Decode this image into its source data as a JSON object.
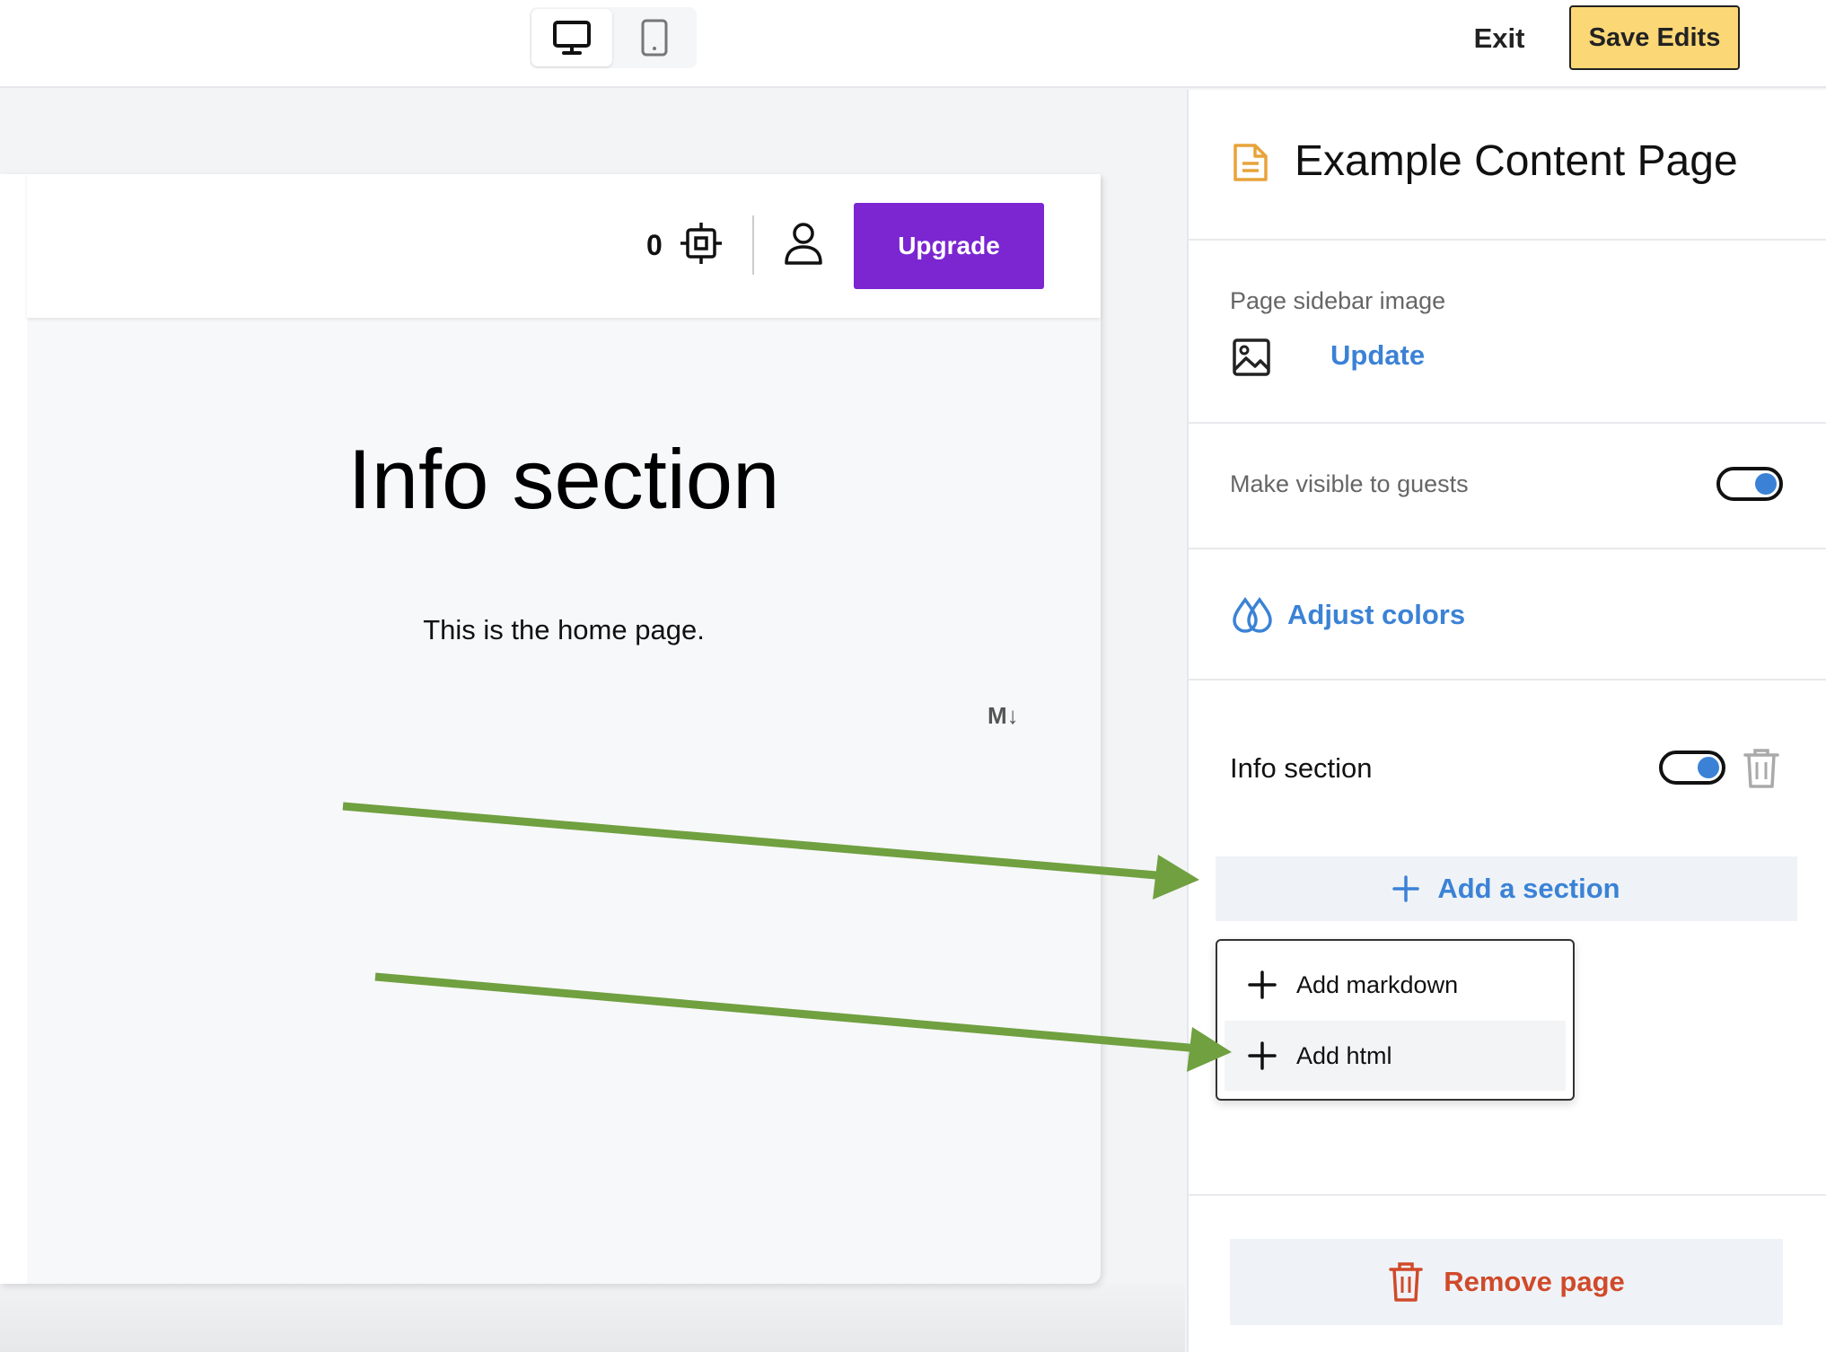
{
  "topbar": {
    "exit_label": "Exit",
    "save_label": "Save Edits",
    "device_desktop": "desktop-icon",
    "device_tablet": "tablet-icon"
  },
  "preview": {
    "credit_count": "0",
    "upgrade_label": "Upgrade",
    "info_title": "Info section",
    "info_body": "This is the home page.",
    "markdown_badge": "M↓"
  },
  "panel": {
    "page_title": "Example Content Page",
    "sidebar_image_label": "Page sidebar image",
    "update_label": "Update",
    "visible_label": "Make visible to guests",
    "visible_on": true,
    "adjust_colors_label": "Adjust colors",
    "section_label": "Info section",
    "section_on": true,
    "add_section_label": "Add a section",
    "dropdown": {
      "items": [
        {
          "label": "Add markdown"
        },
        {
          "label": "Add html"
        }
      ]
    },
    "remove_page_label": "Remove page"
  },
  "colors": {
    "accent_blue": "#3b82d6",
    "upgrade_purple": "#7b26d1",
    "save_yellow": "#fcd776",
    "danger_red": "#d04a2a",
    "annotation_green": "#70a040",
    "page_icon_orange": "#e8a33a"
  }
}
